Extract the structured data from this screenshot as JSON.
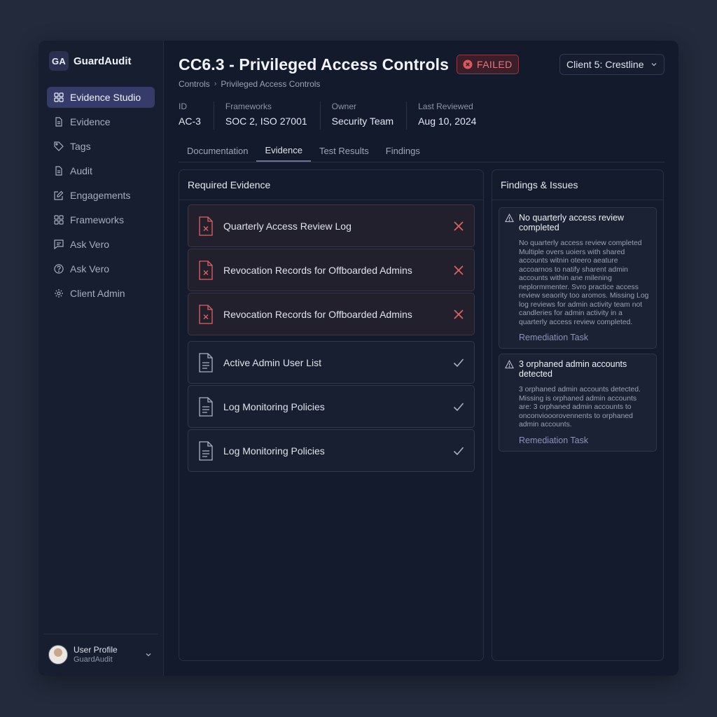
{
  "brand": {
    "logo": "GA",
    "name": "GuardAudit"
  },
  "sidebar": {
    "items": [
      {
        "label": "Evidence Studio",
        "icon": "grid-icon",
        "active": true
      },
      {
        "label": "Evidence",
        "icon": "file-icon"
      },
      {
        "label": "Tags",
        "icon": "tag-icon"
      },
      {
        "label": "Audit",
        "icon": "file-icon"
      },
      {
        "label": "Engagements",
        "icon": "edit-icon"
      },
      {
        "label": "Frameworks",
        "icon": "grid-icon"
      },
      {
        "label": "Ask Vero",
        "icon": "chat-icon"
      },
      {
        "label": "Ask Vero",
        "icon": "help-icon"
      },
      {
        "label": "Client Admin",
        "icon": "gear-icon"
      }
    ]
  },
  "profile": {
    "name": "User Profile",
    "org": "GuardAudit"
  },
  "header": {
    "title": "CC6.3 - Privileged Access Controls",
    "status": "FAILED",
    "client": "Client 5: Crestline"
  },
  "breadcrumb": {
    "root": "Controls",
    "current": "Privileged Access Controls"
  },
  "meta": [
    {
      "label": "ID",
      "value": "AC-3"
    },
    {
      "label": "Frameworks",
      "value": "SOC 2, ISO 27001"
    },
    {
      "label": "Owner",
      "value": "Security Team"
    },
    {
      "label": "Last Reviewed",
      "value": "Aug 10, 2024"
    }
  ],
  "tabs": [
    "Documentation",
    "Evidence",
    "Test Results",
    "Findings"
  ],
  "active_tab": "Evidence",
  "evidence": {
    "title": "Required Evidence",
    "items": [
      {
        "label": "Quarterly Access Review Log",
        "status": "failed"
      },
      {
        "label": "Revocation Records for Offboarded Admins",
        "status": "failed"
      },
      {
        "label": "Revocation Records for Offboarded Admins",
        "status": "failed"
      },
      {
        "label": "Active Admin User List",
        "status": "passed"
      },
      {
        "label": "Log Monitoring Policies",
        "status": "passed"
      },
      {
        "label": "Log Monitoring Policies",
        "status": "passed"
      }
    ]
  },
  "findings": {
    "title": "Findings & Issues",
    "items": [
      {
        "title": "No quarterly access review completed",
        "body": "No quarterly access review completed Multiple overs uoiers with shared accounts witnin oteero aeature accoarnos to natify sharent admin accounts within ane milening neplormmenter. Svro practice access review seaority too aromos. Missing Log log reviews for admin activity team not candleries for admin activity in a quarterly access review completed.",
        "link": "Remediation Task"
      },
      {
        "title": "3 orphaned admin accounts detected",
        "body": "3 orphaned admin accounts detected. Missing is orphaned admin accounts are: 3 orphaned admin accounts to onconviooorovennents to orphaned admin accounts.",
        "link": "Remediation Task"
      }
    ]
  },
  "colors": {
    "accent": "#363c6a",
    "fail": "#e0625f",
    "pass": "#aab1c2",
    "bg": "#131a2c"
  }
}
